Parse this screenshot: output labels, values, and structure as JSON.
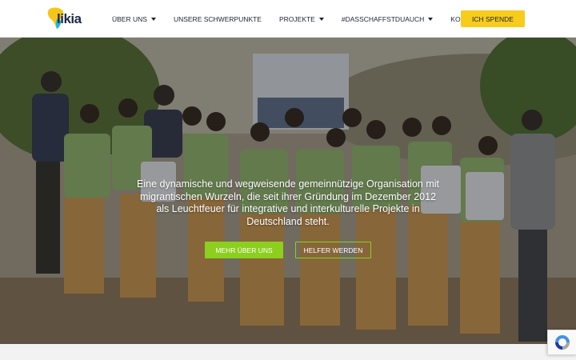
{
  "logo": {
    "text": "likia",
    "icon": "elikia-africa-logo"
  },
  "nav": {
    "items": [
      {
        "label": "ÜBER UNS",
        "dropdown": true
      },
      {
        "label": "UNSERE SCHWERPUNKTE",
        "dropdown": false
      },
      {
        "label": "PROJEKTE",
        "dropdown": true
      },
      {
        "label": "#DASSCHAFFSTDUAUCH",
        "dropdown": true
      },
      {
        "label": "KONTAKT",
        "dropdown": false
      }
    ],
    "donate_label": "ICH SPENDE"
  },
  "hero": {
    "text": "Eine dynamische und wegweisende gemeinnützige Organisation mit migrantischen Wurzeln, die seit ihrer Gründung im Dezember 2012 als Leuchtfeuer für integrative und interkulturelle Projekte in Deutschland steht.",
    "primary_button": "MEHR ÜBER UNS",
    "secondary_button": "HELFER WERDEN"
  },
  "colors": {
    "accent_green": "#8ccf1e",
    "donate_yellow": "#f7cc1c",
    "nav_text": "#1f2233"
  },
  "icons": {
    "recaptcha": "recaptcha-icon"
  }
}
